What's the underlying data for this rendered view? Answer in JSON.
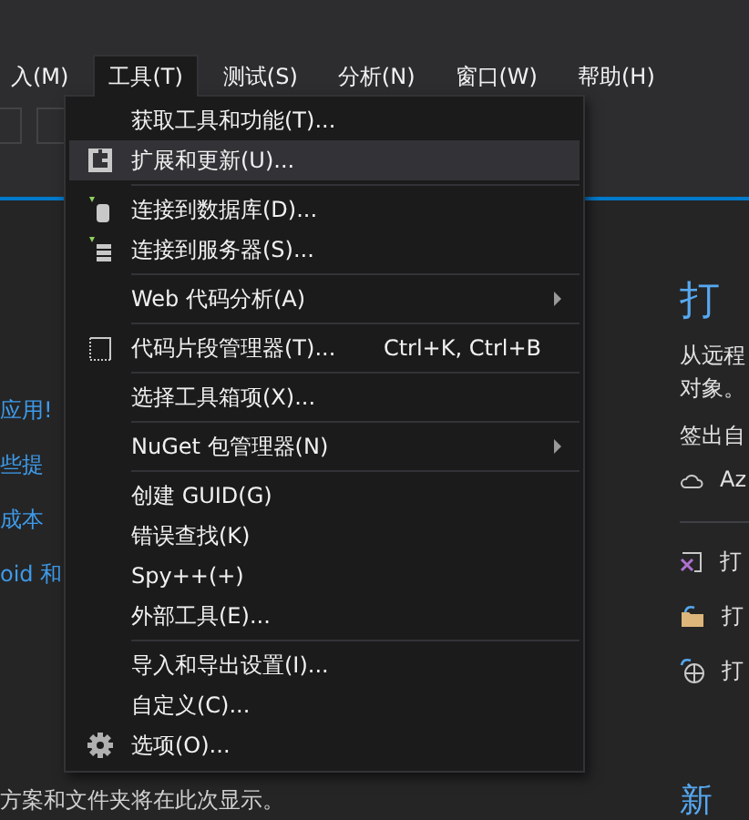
{
  "menu_bar": [
    {
      "label": "入(M)",
      "selected": false
    },
    {
      "label": "工具(T)",
      "selected": true
    },
    {
      "label": "测试(S)",
      "selected": false
    },
    {
      "label": "分析(N)",
      "selected": false
    },
    {
      "label": "窗口(W)",
      "selected": false
    },
    {
      "label": "帮助(H)",
      "selected": false
    }
  ],
  "dropdown": {
    "groups": [
      [
        {
          "label": "获取工具和功能(T)...",
          "highlighted": false,
          "submenu": false
        },
        {
          "label": "扩展和更新(U)...",
          "highlighted": true,
          "submenu": false
        }
      ],
      [
        {
          "label": "连接到数据库(D)...",
          "highlighted": false,
          "submenu": false
        },
        {
          "label": "连接到服务器(S)...",
          "highlighted": false,
          "submenu": false
        }
      ],
      [
        {
          "label": "Web 代码分析(A)",
          "highlighted": false,
          "submenu": true
        }
      ],
      [
        {
          "label": "代码片段管理器(T)...",
          "shortcut": "Ctrl+K, Ctrl+B",
          "highlighted": false,
          "submenu": false
        }
      ],
      [
        {
          "label": "选择工具箱项(X)...",
          "highlighted": false,
          "submenu": false
        }
      ],
      [
        {
          "label": "NuGet 包管理器(N)",
          "highlighted": false,
          "submenu": true
        }
      ],
      [
        {
          "label": "创建 GUID(G)",
          "highlighted": false,
          "submenu": false
        },
        {
          "label": "错误查找(K)",
          "highlighted": false,
          "submenu": false
        },
        {
          "label": "Spy++(+)",
          "highlighted": false,
          "submenu": false
        },
        {
          "label": "外部工具(E)...",
          "highlighted": false,
          "submenu": false
        }
      ],
      [
        {
          "label": "导入和导出设置(I)...",
          "highlighted": false,
          "submenu": false
        },
        {
          "label": "自定义(C)...",
          "highlighted": false,
          "submenu": false
        },
        {
          "label": "选项(O)...",
          "highlighted": false,
          "submenu": false
        }
      ]
    ]
  },
  "left_pane": {
    "links": [
      "应用!",
      "些提",
      "成本",
      "oid 和"
    ],
    "footer": "方案和文件夹将在此次显示。"
  },
  "right_pane": {
    "heading": "打",
    "description": [
      "从远程",
      "对象。"
    ],
    "checkout_label": "签出自",
    "cloud_item": "Az",
    "actions": [
      "打",
      "打",
      "打"
    ],
    "bottom_heading": "新"
  }
}
